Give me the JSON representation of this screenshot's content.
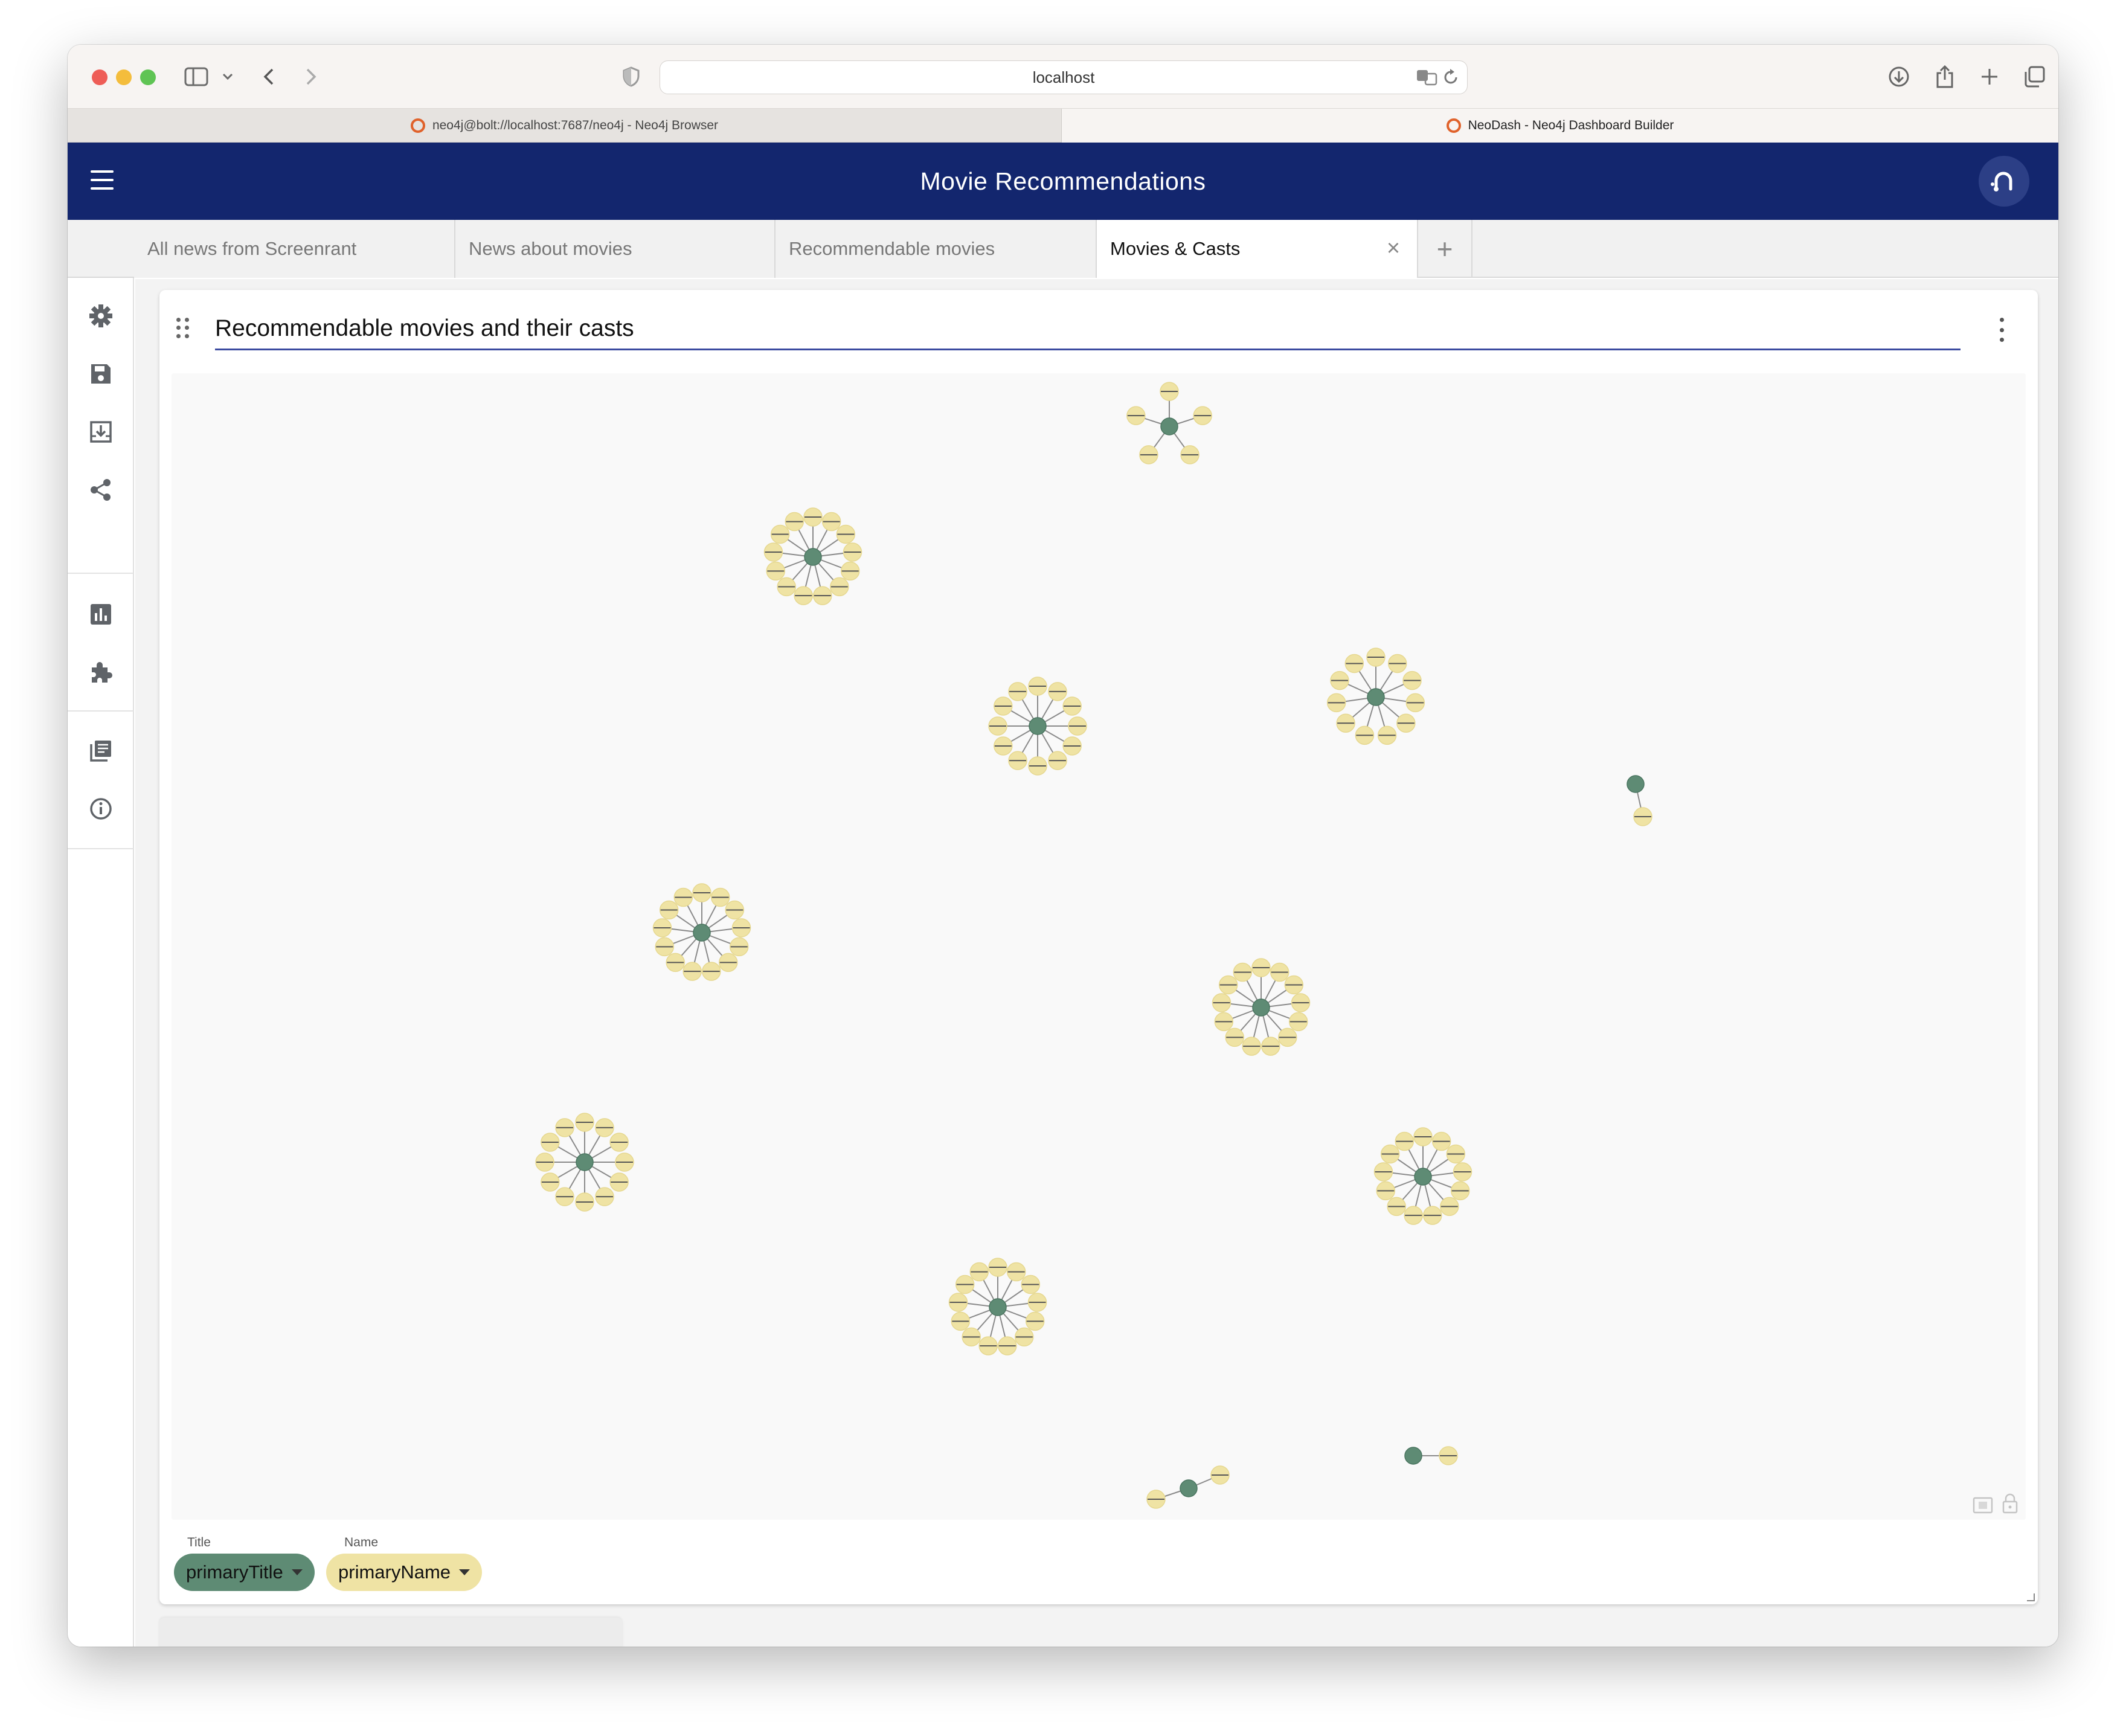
{
  "browser": {
    "url": "localhost",
    "tabs": [
      {
        "label": "neo4j@bolt://localhost:7687/neo4j - Neo4j Browser",
        "active": false
      },
      {
        "label": "NeoDash - Neo4j Dashboard Builder",
        "active": true
      }
    ]
  },
  "app": {
    "title": "Movie Recommendations"
  },
  "dashboard_tabs": [
    {
      "label": "All news from Screenrant",
      "active": false
    },
    {
      "label": "News about movies",
      "active": false
    },
    {
      "label": "Recommendable movies",
      "active": false
    },
    {
      "label": "Movies & Casts",
      "active": true
    }
  ],
  "sidebar": {
    "items": [
      "gear-icon",
      "save-icon",
      "load-icon",
      "share-icon",
      "bar-chart-icon",
      "extension-icon",
      "documentation-icon",
      "info-icon"
    ]
  },
  "report": {
    "title": "Recommendable movies and their casts",
    "legend": [
      {
        "label": "Title",
        "property": "primaryTitle",
        "color": "#5e8b74"
      },
      {
        "label": "Name",
        "property": "primaryName",
        "color": "#efe3a4"
      }
    ]
  },
  "graph": {
    "movie_color": "#5e8b74",
    "person_color": "#efe3a4",
    "clusters": [
      {
        "count": 5
      },
      {
        "count": 13
      },
      {
        "count": 11
      },
      {
        "count": 12
      },
      {
        "count": 1
      },
      {
        "count": 13
      },
      {
        "count": 13
      },
      {
        "count": 12
      },
      {
        "count": 13
      },
      {
        "count": 13
      },
      {
        "count": 1
      },
      {
        "count": 2
      }
    ]
  }
}
